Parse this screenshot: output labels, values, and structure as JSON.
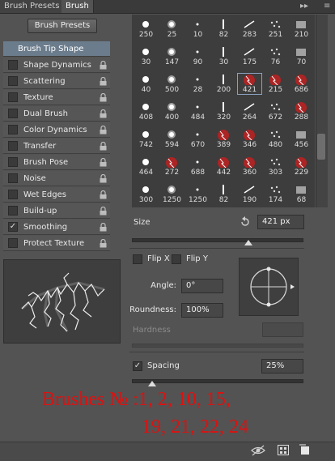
{
  "tabs": [
    {
      "label": "Brush Presets"
    },
    {
      "label": "Brush"
    }
  ],
  "tab_controls": {
    "collapse": "▸▸",
    "menu": "≡"
  },
  "brush_presets_button": "Brush Presets",
  "settings_list": [
    {
      "label": "Brush Tip Shape",
      "checkbox": false,
      "checked": false,
      "lock": false,
      "selected": true
    },
    {
      "label": "Shape Dynamics",
      "checkbox": true,
      "checked": false,
      "lock": true
    },
    {
      "label": "Scattering",
      "checkbox": true,
      "checked": false,
      "lock": true
    },
    {
      "label": "Texture",
      "checkbox": true,
      "checked": false,
      "lock": true
    },
    {
      "label": "Dual Brush",
      "checkbox": true,
      "checked": false,
      "lock": true
    },
    {
      "label": "Color Dynamics",
      "checkbox": true,
      "checked": false,
      "lock": true
    },
    {
      "label": "Transfer",
      "checkbox": true,
      "checked": false,
      "lock": true
    },
    {
      "label": "Brush Pose",
      "checkbox": true,
      "checked": false,
      "lock": true
    },
    {
      "label": "Noise",
      "checkbox": true,
      "checked": false,
      "lock": true
    },
    {
      "label": "Wet Edges",
      "checkbox": true,
      "checked": false,
      "lock": true
    },
    {
      "label": "Build-up",
      "checkbox": true,
      "checked": false,
      "lock": true
    },
    {
      "label": "Smoothing",
      "checkbox": true,
      "checked": true,
      "lock": true
    },
    {
      "label": "Protect Texture",
      "checkbox": true,
      "checked": false,
      "lock": true
    }
  ],
  "brush_grid": {
    "rows": [
      [
        "250",
        "25",
        "10",
        "82",
        "283",
        "251",
        "210"
      ],
      [
        "30",
        "147",
        "90",
        "30",
        "175",
        "76",
        "70"
      ],
      [
        "40",
        "500",
        "28",
        "200",
        "421",
        "215",
        "686"
      ],
      [
        "408",
        "400",
        "484",
        "320",
        "264",
        "672",
        "288"
      ],
      [
        "742",
        "594",
        "670",
        "389",
        "346",
        "480",
        "456"
      ],
      [
        "464",
        "272",
        "688",
        "442",
        "360",
        "303",
        "229"
      ],
      [
        "300",
        "1250",
        "1250",
        "82",
        "190",
        "174",
        "68"
      ]
    ],
    "highlighted": [
      "421",
      "215",
      "686",
      "288",
      "389",
      "346",
      "272",
      "442",
      "360",
      "229"
    ],
    "selected": "421",
    "accent": "#c02020"
  },
  "size": {
    "label": "Size",
    "value": "421 px",
    "level": 0.68
  },
  "flip_x": {
    "label": "Flip X",
    "checked": false
  },
  "flip_y": {
    "label": "Flip Y",
    "checked": false
  },
  "angle": {
    "label": "Angle:",
    "value": "0°"
  },
  "roundness": {
    "label": "Roundness:",
    "value": "100%"
  },
  "hardness": {
    "label": "Hardness"
  },
  "spacing": {
    "label": "Spacing",
    "checked": true,
    "value": "25%",
    "level": 0.12
  },
  "note": {
    "line1": "Brushes № :1, 2, 10, 15,",
    "line2": "19, 21, 22, 24",
    "color": "#e01010"
  },
  "icons": [
    "reset-size-icon",
    "brush-preview-icon",
    "create-new-brush-icon",
    "panel-menu-icon",
    "toggle-preview-icon",
    "lock-icon"
  ]
}
